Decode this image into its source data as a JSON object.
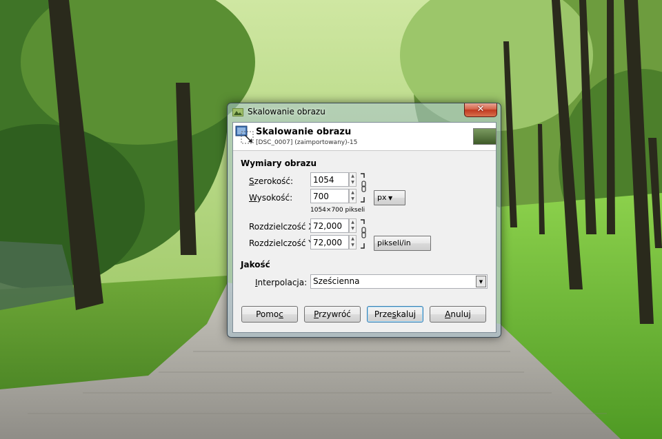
{
  "window": {
    "title": "Skalowanie obrazu",
    "close_glyph": "✕"
  },
  "header": {
    "title": "Skalowanie obrazu",
    "subtitle": "[DSC_0007] (zaimportowany)-15"
  },
  "dimensions": {
    "section_label": "Wymiary obrazu",
    "width_label": "Szerokość:",
    "width_value": "1054",
    "height_label": "Wysokość:",
    "height_value": "700",
    "size_info": "1054×700 pikseli",
    "unit": "px",
    "res_x_label": "Rozdzielczość X:",
    "res_x_value": "72,000",
    "res_y_label": "Rozdzielczość Y:",
    "res_y_value": "72,000",
    "res_unit": "pikseli/in"
  },
  "quality": {
    "section_label": "Jakość",
    "interpolation_label": "Interpolacja:",
    "interpolation_value": "Sześcienna"
  },
  "buttons": {
    "help": "Pomoc",
    "reset": "Przywróć",
    "scale": "Przeskaluj",
    "cancel": "Anuluj"
  },
  "colors": {
    "default_button_border": "#3c7fb1",
    "close_button": "#c0391f"
  }
}
